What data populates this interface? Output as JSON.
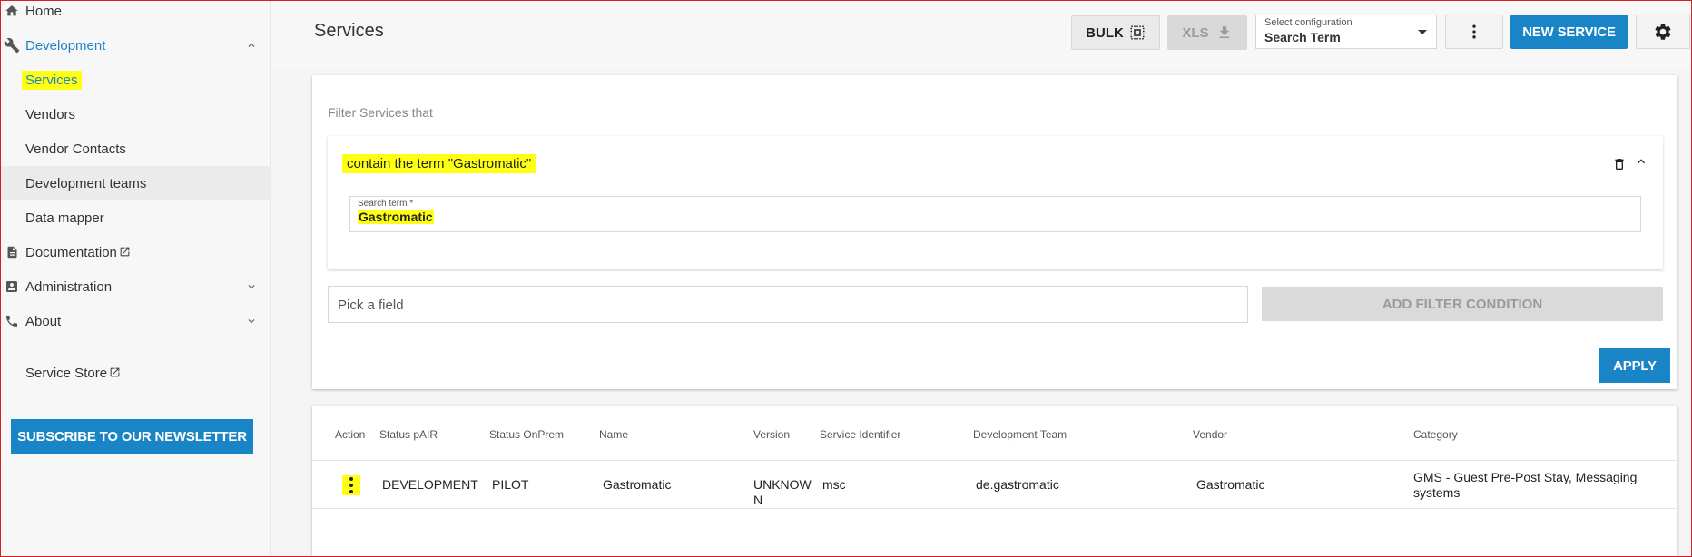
{
  "sidebar": {
    "home": "Home",
    "development": "Development",
    "services": "Services",
    "vendors": "Vendors",
    "vendor_contacts": "Vendor Contacts",
    "development_teams": "Development teams",
    "data_mapper": "Data mapper",
    "documentation": "Documentation",
    "administration": "Administration",
    "about": "About",
    "service_store": "Service Store",
    "newsletter": "SUBSCRIBE TO OUR NEWSLETTER"
  },
  "header": {
    "title": "Services",
    "bulk": "BULK",
    "xls": "XLS",
    "config_label": "Select configuration",
    "config_value": "Search Term",
    "new_service": "NEW SERVICE"
  },
  "filter": {
    "heading": "Filter Services that",
    "condition_title": "contain the term \"Gastromatic\"",
    "search_label": "Search term *",
    "search_value": "Gastromatic",
    "pick_placeholder": "Pick a field",
    "add_condition": "ADD FILTER CONDITION",
    "apply": "APPLY"
  },
  "table": {
    "columns": [
      "Action",
      "Status pAIR",
      "Status OnPrem",
      "Name",
      "Version",
      "Service Identifier",
      "Development Team",
      "Vendor",
      "Category"
    ],
    "rows": [
      {
        "status_pair": "DEVELOPMENT",
        "status_onprem": "PILOT",
        "name": "Gastromatic",
        "version_line1": "UNKNOW",
        "version_line2": "N",
        "service_identifier": "msc",
        "development_team": "de.gastromatic",
        "vendor": "Gastromatic",
        "category_line1": "GMS - Guest Pre-Post Stay, Messaging",
        "category_line2": "systems"
      }
    ]
  },
  "colors": {
    "primary": "#1a85c6",
    "highlight": "#ffff14",
    "border_red": "#d32020"
  }
}
